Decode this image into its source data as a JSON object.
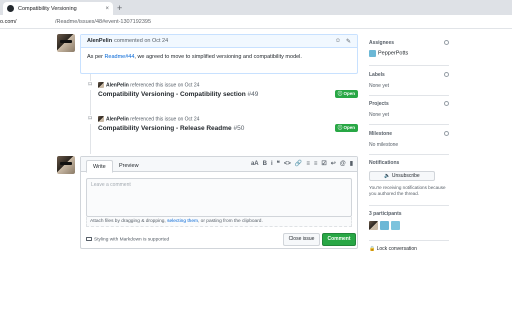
{
  "browser": {
    "tab_title": "Compatibility Versioning",
    "tab_close": "×",
    "new_tab": "+",
    "address_host": "o.com/",
    "address_path": "/Readme/issues/48#event-1307192395"
  },
  "comment": {
    "author": "AlenPelin",
    "action": "commented on Oct 24",
    "body_before": "As per ",
    "body_link": "Readme#44",
    "body_after": ", we agreed to move to simplified versioning and compatibility model.",
    "reaction_icon": "☺",
    "edit_icon": "✎"
  },
  "events": [
    {
      "author": "AlenPelin",
      "action": "referenced this issue on Oct 24",
      "title": "Compatibility Versioning - Compatibility section",
      "number": "#49",
      "badge": "Open"
    },
    {
      "author": "AlenPelin",
      "action": "referenced this issue on Oct 24",
      "title": "Compatibility Versioning - Release Readme",
      "number": "#50",
      "badge": "Open"
    }
  ],
  "new_comment": {
    "tab_write": "Write",
    "tab_preview": "Preview",
    "toolbar": [
      "aA",
      "B",
      "i",
      "❝",
      "<>",
      "🔗",
      "≡",
      "≡",
      "☑",
      "↩",
      "@",
      "▮"
    ],
    "placeholder": "Leave a comment",
    "attach_before": "Attach files by dragging & dropping, ",
    "attach_link": "selecting them",
    "attach_after": ", or pasting from the clipboard.",
    "markdown_note": "Styling with Markdown is supported",
    "close_issue": "Close issue",
    "comment_button": "Comment"
  },
  "sidebar": {
    "assignees_heading": "Assignees",
    "assignee": "PepperPotts",
    "labels_heading": "Labels",
    "labels_value": "None yet",
    "projects_heading": "Projects",
    "projects_value": "None yet",
    "milestone_heading": "Milestone",
    "milestone_value": "No milestone",
    "notifications_heading": "Notifications",
    "unsubscribe": "Unsubscribe",
    "notice": "You're receiving notifications because you authored the thread.",
    "participants_heading": "3 participants",
    "lock": "Lock conversation"
  },
  "colors": {
    "open_badge": "#28a745",
    "link": "#0366d6",
    "comment_header": "#f1f8ff"
  }
}
